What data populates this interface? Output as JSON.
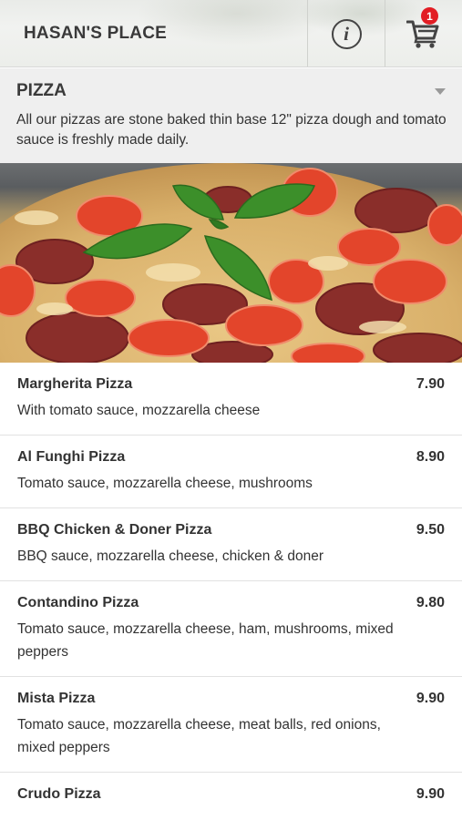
{
  "header": {
    "title": "HASAN'S PLACE",
    "info_icon": "info-icon",
    "cart_icon": "cart-icon",
    "cart_count": "1"
  },
  "category": {
    "title": "PIZZA",
    "description": "All our pizzas are stone baked thin base 12\" pizza dough and tomato sauce is freshly made daily."
  },
  "items": [
    {
      "name": "Margherita Pizza",
      "price": "7.90",
      "description": "With tomato sauce, mozzarella cheese"
    },
    {
      "name": "Al Funghi Pizza",
      "price": "8.90",
      "description": "Tomato sauce, mozzarella cheese, mushrooms"
    },
    {
      "name": "BBQ Chicken & Doner Pizza",
      "price": "9.50",
      "description": "BBQ sauce, mozzarella cheese, chicken & doner"
    },
    {
      "name": "Contandino Pizza",
      "price": "9.80",
      "description": "Tomato sauce, mozzarella cheese, ham, mushrooms, mixed peppers"
    },
    {
      "name": "Mista Pizza",
      "price": "9.90",
      "description": "Tomato sauce, mozzarella cheese, meat balls, red onions, mixed peppers"
    },
    {
      "name": "Crudo Pizza",
      "price": "9.90",
      "description": ""
    }
  ],
  "colors": {
    "badge": "#e21d24",
    "header_bg": "#eceeea",
    "category_bg": "#efefef"
  }
}
